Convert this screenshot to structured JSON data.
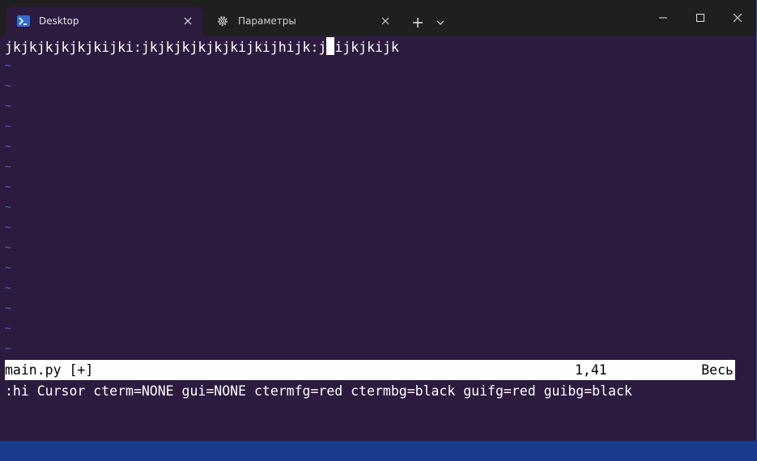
{
  "tabs": [
    {
      "label": "Desktop",
      "icon": "powershell-icon",
      "active": true
    },
    {
      "label": "Параметры",
      "icon": "gear-icon",
      "active": false
    }
  ],
  "editor": {
    "line1_before_cursor": "jkjkjkjkjkjkijki:jkjkjkjkjkjkijkijhijk:j",
    "line1_after_cursor": "ijkjkijk",
    "tilde_glyph": "~",
    "status_file": "main.py [+]",
    "status_position": "1,41",
    "status_scroll": "Весь",
    "command_line": ":hi Cursor cterm=NONE gui=NONE ctermfg=red ctermbg=black guifg=red guibg=black"
  },
  "colors": {
    "background": "#2c1a3f",
    "titlebar": "#1f1f1f",
    "tilde": "#4a6ad0",
    "statusbar_bg": "#ffffff"
  }
}
